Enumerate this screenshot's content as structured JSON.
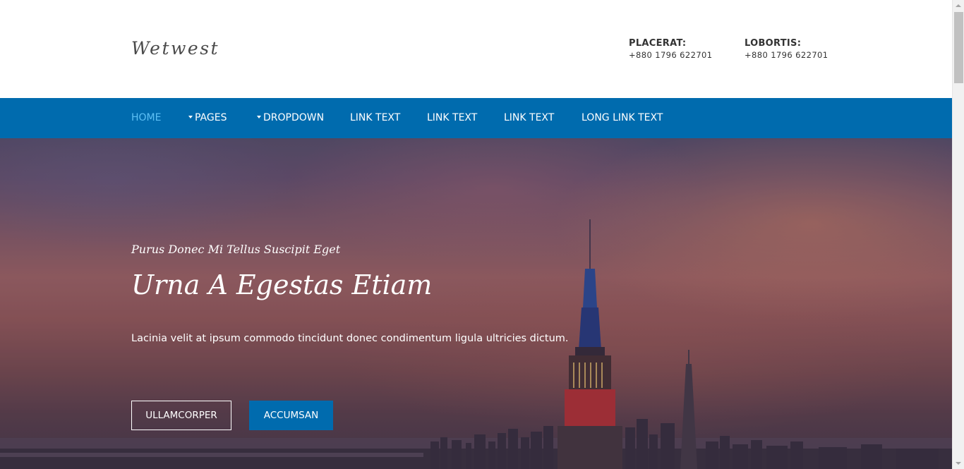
{
  "header": {
    "logo": "Wetwest",
    "contacts": [
      {
        "label": "PLACERAT:",
        "value": "+880 1796 622701"
      },
      {
        "label": "LOBORTIS:",
        "value": "+880 1796 622701"
      }
    ]
  },
  "nav": {
    "items": [
      {
        "label": "HOME",
        "active": true,
        "dropdown": false
      },
      {
        "label": "PAGES",
        "active": false,
        "dropdown": true
      },
      {
        "label": "DROPDOWN",
        "active": false,
        "dropdown": true
      },
      {
        "label": "LINK TEXT",
        "active": false,
        "dropdown": false
      },
      {
        "label": "LINK TEXT",
        "active": false,
        "dropdown": false
      },
      {
        "label": "LINK TEXT",
        "active": false,
        "dropdown": false
      },
      {
        "label": "LONG LINK TEXT",
        "active": false,
        "dropdown": false
      }
    ]
  },
  "hero": {
    "subtitle": "Purus Donec Mi Tellus Suscipit Eget",
    "title": "Urna A Egestas Etiam",
    "description": "Lacinia velit at ipsum commodo tincidunt donec condimentum ligula ultricies dictum.",
    "buttons": {
      "primary_outline": "ULLAMCORPER",
      "secondary_solid": "ACCUMSAN"
    },
    "background": "city skyline at sunset"
  },
  "colors": {
    "nav_bg": "#006bae",
    "nav_active": "#5ec0f5",
    "button_solid": "#006bae",
    "text_dark": "#333333"
  }
}
